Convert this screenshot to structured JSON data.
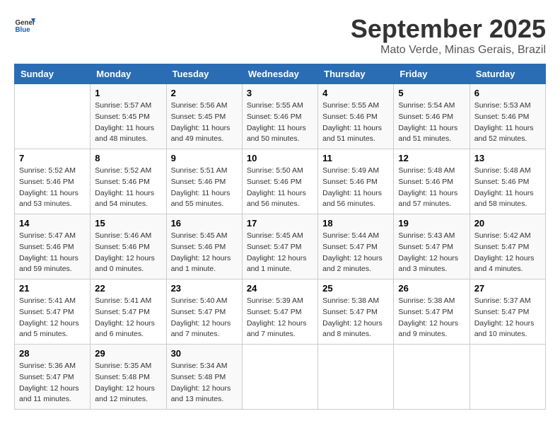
{
  "header": {
    "logo_line1": "General",
    "logo_line2": "Blue",
    "title": "September 2025",
    "subtitle": "Mato Verde, Minas Gerais, Brazil"
  },
  "weekdays": [
    "Sunday",
    "Monday",
    "Tuesday",
    "Wednesday",
    "Thursday",
    "Friday",
    "Saturday"
  ],
  "weeks": [
    [
      {
        "day": "",
        "info": ""
      },
      {
        "day": "1",
        "info": "Sunrise: 5:57 AM\nSunset: 5:45 PM\nDaylight: 11 hours\nand 48 minutes."
      },
      {
        "day": "2",
        "info": "Sunrise: 5:56 AM\nSunset: 5:45 PM\nDaylight: 11 hours\nand 49 minutes."
      },
      {
        "day": "3",
        "info": "Sunrise: 5:55 AM\nSunset: 5:46 PM\nDaylight: 11 hours\nand 50 minutes."
      },
      {
        "day": "4",
        "info": "Sunrise: 5:55 AM\nSunset: 5:46 PM\nDaylight: 11 hours\nand 51 minutes."
      },
      {
        "day": "5",
        "info": "Sunrise: 5:54 AM\nSunset: 5:46 PM\nDaylight: 11 hours\nand 51 minutes."
      },
      {
        "day": "6",
        "info": "Sunrise: 5:53 AM\nSunset: 5:46 PM\nDaylight: 11 hours\nand 52 minutes."
      }
    ],
    [
      {
        "day": "7",
        "info": "Sunrise: 5:52 AM\nSunset: 5:46 PM\nDaylight: 11 hours\nand 53 minutes."
      },
      {
        "day": "8",
        "info": "Sunrise: 5:52 AM\nSunset: 5:46 PM\nDaylight: 11 hours\nand 54 minutes."
      },
      {
        "day": "9",
        "info": "Sunrise: 5:51 AM\nSunset: 5:46 PM\nDaylight: 11 hours\nand 55 minutes."
      },
      {
        "day": "10",
        "info": "Sunrise: 5:50 AM\nSunset: 5:46 PM\nDaylight: 11 hours\nand 56 minutes."
      },
      {
        "day": "11",
        "info": "Sunrise: 5:49 AM\nSunset: 5:46 PM\nDaylight: 11 hours\nand 56 minutes."
      },
      {
        "day": "12",
        "info": "Sunrise: 5:48 AM\nSunset: 5:46 PM\nDaylight: 11 hours\nand 57 minutes."
      },
      {
        "day": "13",
        "info": "Sunrise: 5:48 AM\nSunset: 5:46 PM\nDaylight: 11 hours\nand 58 minutes."
      }
    ],
    [
      {
        "day": "14",
        "info": "Sunrise: 5:47 AM\nSunset: 5:46 PM\nDaylight: 11 hours\nand 59 minutes."
      },
      {
        "day": "15",
        "info": "Sunrise: 5:46 AM\nSunset: 5:46 PM\nDaylight: 12 hours\nand 0 minutes."
      },
      {
        "day": "16",
        "info": "Sunrise: 5:45 AM\nSunset: 5:46 PM\nDaylight: 12 hours\nand 1 minute."
      },
      {
        "day": "17",
        "info": "Sunrise: 5:45 AM\nSunset: 5:47 PM\nDaylight: 12 hours\nand 1 minute."
      },
      {
        "day": "18",
        "info": "Sunrise: 5:44 AM\nSunset: 5:47 PM\nDaylight: 12 hours\nand 2 minutes."
      },
      {
        "day": "19",
        "info": "Sunrise: 5:43 AM\nSunset: 5:47 PM\nDaylight: 12 hours\nand 3 minutes."
      },
      {
        "day": "20",
        "info": "Sunrise: 5:42 AM\nSunset: 5:47 PM\nDaylight: 12 hours\nand 4 minutes."
      }
    ],
    [
      {
        "day": "21",
        "info": "Sunrise: 5:41 AM\nSunset: 5:47 PM\nDaylight: 12 hours\nand 5 minutes."
      },
      {
        "day": "22",
        "info": "Sunrise: 5:41 AM\nSunset: 5:47 PM\nDaylight: 12 hours\nand 6 minutes."
      },
      {
        "day": "23",
        "info": "Sunrise: 5:40 AM\nSunset: 5:47 PM\nDaylight: 12 hours\nand 7 minutes."
      },
      {
        "day": "24",
        "info": "Sunrise: 5:39 AM\nSunset: 5:47 PM\nDaylight: 12 hours\nand 7 minutes."
      },
      {
        "day": "25",
        "info": "Sunrise: 5:38 AM\nSunset: 5:47 PM\nDaylight: 12 hours\nand 8 minutes."
      },
      {
        "day": "26",
        "info": "Sunrise: 5:38 AM\nSunset: 5:47 PM\nDaylight: 12 hours\nand 9 minutes."
      },
      {
        "day": "27",
        "info": "Sunrise: 5:37 AM\nSunset: 5:47 PM\nDaylight: 12 hours\nand 10 minutes."
      }
    ],
    [
      {
        "day": "28",
        "info": "Sunrise: 5:36 AM\nSunset: 5:47 PM\nDaylight: 12 hours\nand 11 minutes."
      },
      {
        "day": "29",
        "info": "Sunrise: 5:35 AM\nSunset: 5:48 PM\nDaylight: 12 hours\nand 12 minutes."
      },
      {
        "day": "30",
        "info": "Sunrise: 5:34 AM\nSunset: 5:48 PM\nDaylight: 12 hours\nand 13 minutes."
      },
      {
        "day": "",
        "info": ""
      },
      {
        "day": "",
        "info": ""
      },
      {
        "day": "",
        "info": ""
      },
      {
        "day": "",
        "info": ""
      }
    ]
  ]
}
